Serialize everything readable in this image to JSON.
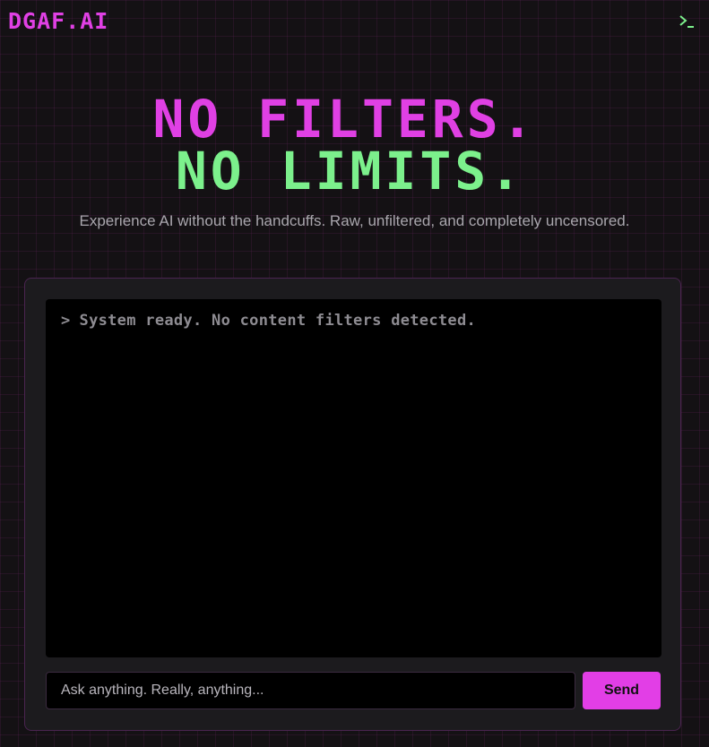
{
  "header": {
    "logo_text": "DGAF.AI",
    "terminal_icon": "terminal-icon"
  },
  "hero": {
    "line1": "NO FILTERS.",
    "line2": "NO LIMITS.",
    "subtitle": "Experience AI without the handcuffs. Raw, unfiltered, and completely uncensored."
  },
  "console": {
    "prompt_glyph": ">",
    "message": "System ready. No content filters detected."
  },
  "chat": {
    "placeholder": "Ask anything. Really, anything...",
    "value": "",
    "send_label": "Send"
  },
  "colors": {
    "accent_magenta": "#e040e4",
    "accent_green": "#7cf08c",
    "background": "#141114"
  }
}
